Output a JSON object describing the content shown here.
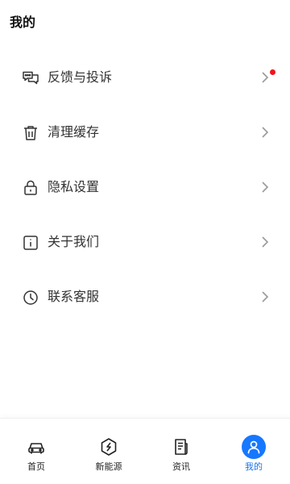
{
  "header": {
    "title": "我的"
  },
  "menu": {
    "items": [
      {
        "label": "反馈与投诉",
        "icon": "chat-bubbles-icon",
        "badge": true
      },
      {
        "label": "清理缓存",
        "icon": "trash-icon",
        "badge": false
      },
      {
        "label": "隐私设置",
        "icon": "lock-icon",
        "badge": false
      },
      {
        "label": "关于我们",
        "icon": "info-icon",
        "badge": false
      },
      {
        "label": "联系客服",
        "icon": "clock-icon",
        "badge": false
      }
    ]
  },
  "tabbar": {
    "tabs": [
      {
        "label": "首页",
        "icon": "car-icon"
      },
      {
        "label": "新能源",
        "icon": "ev-bolt-icon"
      },
      {
        "label": "资讯",
        "icon": "news-icon"
      },
      {
        "label": "我的",
        "icon": "user-icon",
        "active": true
      }
    ]
  },
  "colors": {
    "accent": "#1677ff",
    "badge": "#f0141e",
    "text": "#333333"
  }
}
